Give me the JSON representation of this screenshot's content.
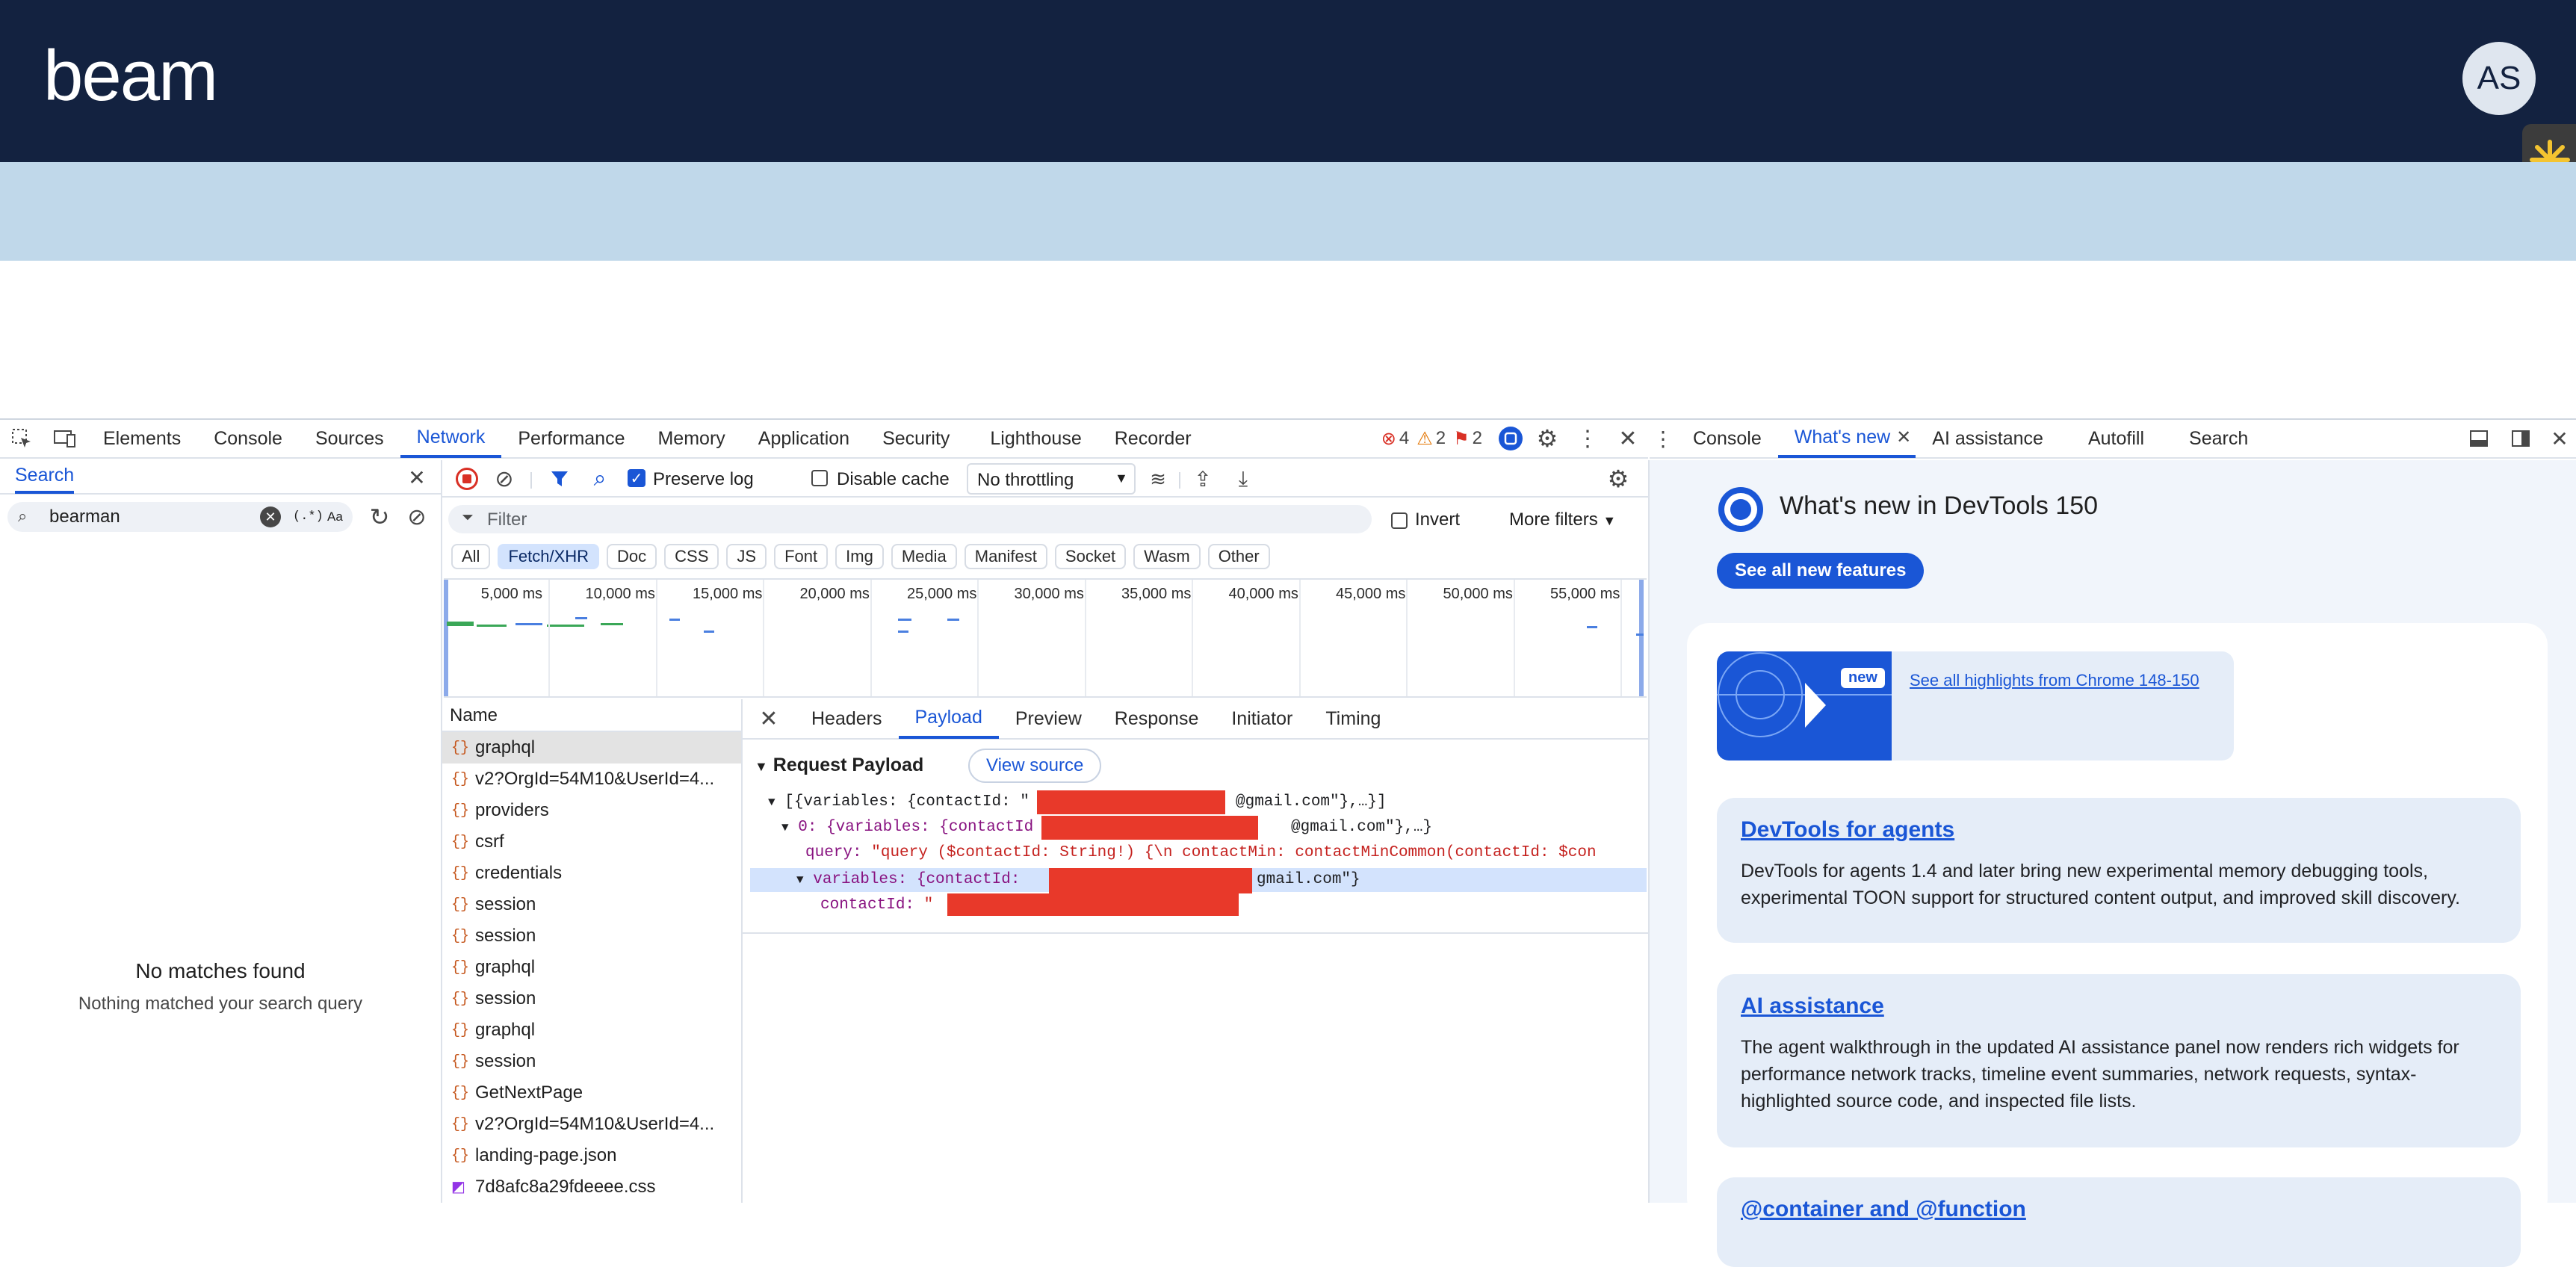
{
  "app": {
    "logo": "beam",
    "avatar_initials": "AS"
  },
  "devtools": {
    "tabs": [
      "Elements",
      "Console",
      "Sources",
      "Network",
      "Performance",
      "Memory",
      "Application",
      "Security",
      "Lighthouse",
      "Recorder"
    ],
    "active_tab": "Network",
    "issues": {
      "errors": "4",
      "warnings": "2",
      "info": "2"
    },
    "search": {
      "title": "Search",
      "query": "bearman",
      "regex_label": "(.*)",
      "case_label": "Aa",
      "empty_title": "No matches found",
      "empty_subtitle": "Nothing matched your search query"
    },
    "network": {
      "preserve_log": "Preserve log",
      "disable_cache": "Disable cache",
      "throttling": "No throttling",
      "filter_placeholder": "Filter",
      "invert": "Invert",
      "more_filters": "More filters",
      "type_filters": [
        "All",
        "Fetch/XHR",
        "Doc",
        "CSS",
        "JS",
        "Font",
        "Img",
        "Media",
        "Manifest",
        "Socket",
        "Wasm",
        "Other"
      ],
      "active_filter": "Fetch/XHR",
      "timeline_ticks": [
        "5,000 ms",
        "10,000 ms",
        "15,000 ms",
        "20,000 ms",
        "25,000 ms",
        "30,000 ms",
        "35,000 ms",
        "40,000 ms",
        "45,000 ms",
        "50,000 ms",
        "55,000 ms"
      ],
      "name_header": "Name",
      "requests": [
        {
          "name": "graphql",
          "icon": "fetch-icon"
        },
        {
          "name": "v2?OrgId=54M10&UserId=4...",
          "icon": "fetch-icon"
        },
        {
          "name": "providers",
          "icon": "fetch-icon"
        },
        {
          "name": "csrf",
          "icon": "fetch-icon"
        },
        {
          "name": "credentials",
          "icon": "fetch-icon"
        },
        {
          "name": "session",
          "icon": "fetch-icon"
        },
        {
          "name": "session",
          "icon": "fetch-icon"
        },
        {
          "name": "graphql",
          "icon": "fetch-icon"
        },
        {
          "name": "session",
          "icon": "fetch-icon"
        },
        {
          "name": "graphql",
          "icon": "fetch-icon"
        },
        {
          "name": "session",
          "icon": "fetch-icon"
        },
        {
          "name": "GetNextPage",
          "icon": "fetch-icon"
        },
        {
          "name": "v2?OrgId=54M10&UserId=4...",
          "icon": "fetch-icon"
        },
        {
          "name": "landing-page.json",
          "icon": "fetch-icon"
        },
        {
          "name": "7d8afc8a29fdeeee.css",
          "icon": "css-icon"
        }
      ],
      "detail_tabs": [
        "Headers",
        "Payload",
        "Preview",
        "Response",
        "Initiator",
        "Timing"
      ],
      "active_detail_tab": "Payload",
      "payload": {
        "section_title": "Request Payload",
        "view_source": "View source",
        "line1": "[{variables: {contactId: \"",
        "line1_end": "@gmail.com\"},…}]",
        "line2": "0: {variables: {contactId",
        "line2_end": "@gmail.com\"},…}",
        "line3_key": "query:",
        "line3_val": "\"query ($contactId: String!) {\\n  contactMin: contactMinCommon(contactId: $con",
        "line4": "variables: {contactId:",
        "line4_end": "gmail.com\"}",
        "line5_key": "contactId:",
        "line5_val": "\""
      }
    },
    "drawer": {
      "tabs": [
        "Console",
        "What's new",
        "AI assistance",
        "Autofill",
        "Search"
      ],
      "active_tab": "What's new",
      "title": "What's new in DevTools 150",
      "see_all": "See all new features",
      "new_badge": "new",
      "highlights_link": "See all highlights from Chrome 148-150",
      "cards": [
        {
          "title": "DevTools for agents",
          "body": "DevTools for agents 1.4 and later bring new experimental memory debugging tools, experimental TOON support for structured content output, and improved skill discovery."
        },
        {
          "title": "AI assistance",
          "body": "The agent walkthrough in the updated AI assistance panel now renders rich widgets for performance network tracks, timeline event summaries, network requests, syntax-highlighted source code, and inspected file lists."
        },
        {
          "title": "@container and @function",
          "body": ""
        }
      ]
    }
  }
}
